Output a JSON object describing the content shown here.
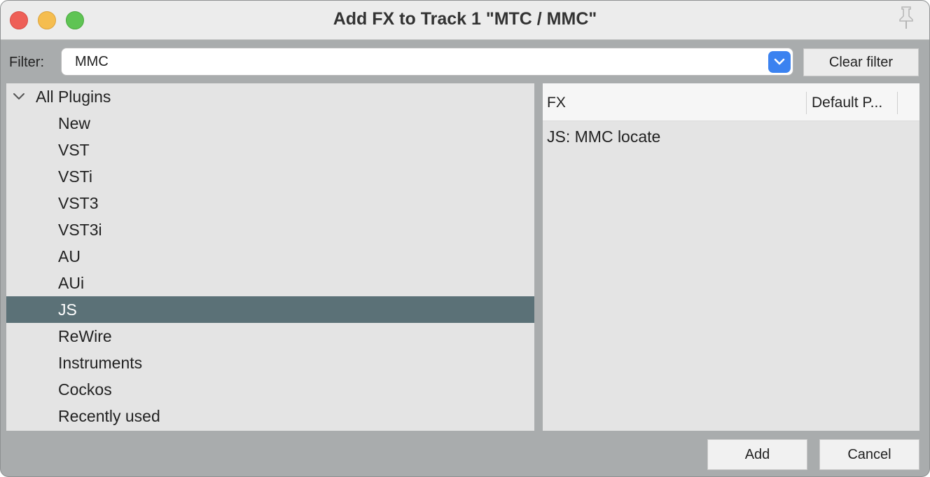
{
  "window": {
    "title": "Add FX to Track 1 \"MTC / MMC\""
  },
  "filter": {
    "label": "Filter:",
    "value": "MMC",
    "clear_label": "Clear filter"
  },
  "tree": {
    "root_label": "All Plugins",
    "items": [
      {
        "label": "New"
      },
      {
        "label": "VST"
      },
      {
        "label": "VSTi"
      },
      {
        "label": "VST3"
      },
      {
        "label": "VST3i"
      },
      {
        "label": "AU"
      },
      {
        "label": "AUi"
      },
      {
        "label": "JS"
      },
      {
        "label": "ReWire"
      },
      {
        "label": "Instruments"
      },
      {
        "label": "Cockos"
      },
      {
        "label": "Recently used"
      }
    ],
    "selected": "JS"
  },
  "fx_list": {
    "columns": [
      "FX",
      "Default P..."
    ],
    "rows": [
      {
        "fx": "JS: MMC locate"
      }
    ]
  },
  "buttons": {
    "add": "Add",
    "cancel": "Cancel"
  },
  "colors": {
    "selection": "#5b7177",
    "accent": "#3b82f0"
  }
}
